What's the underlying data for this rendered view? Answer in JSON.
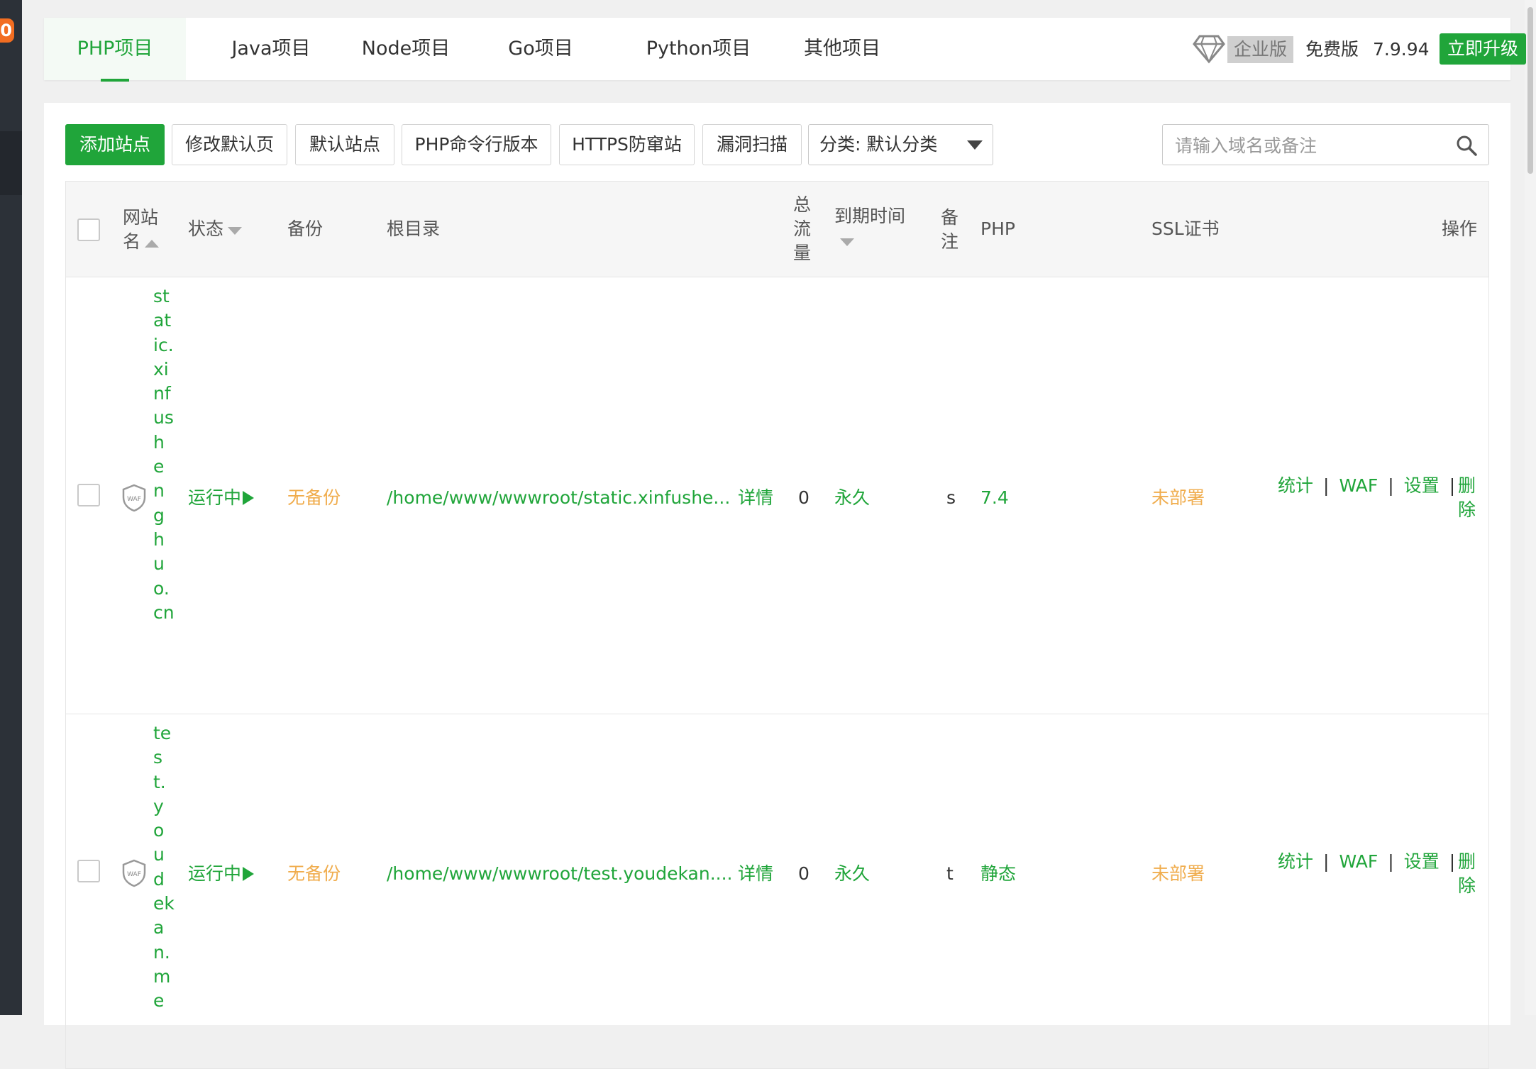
{
  "sidebar": {
    "badge": "0"
  },
  "tabs": [
    {
      "label": "PHP项目"
    },
    {
      "label": "Java项目"
    },
    {
      "label": "Node项目"
    },
    {
      "label": "Go项目"
    },
    {
      "label": "Python项目"
    },
    {
      "label": "其他项目"
    }
  ],
  "version": {
    "enterprise": "企业版",
    "free": "免费版",
    "number": "7.9.94",
    "upgrade": "立即升级"
  },
  "toolbar": {
    "add_site": "添加站点",
    "edit_default_page": "修改默认页",
    "default_site": "默认站点",
    "php_cli": "PHP命令行版本",
    "https_guard": "HTTPS防窜站",
    "vuln_scan": "漏洞扫描",
    "category": "分类: 默认分类",
    "search_placeholder": "请输入域名或备注"
  },
  "columns": {
    "site_name": "网站名",
    "status": "状态",
    "backup": "备份",
    "root": "根目录",
    "traffic": "总流量",
    "expire": "到期时间",
    "remark": "备注",
    "php": "PHP",
    "ssl": "SSL证书",
    "actions": "操作"
  },
  "rows": [
    {
      "name": "static.xinfushenghuo.cn",
      "waf": "WAF",
      "status": "运行中",
      "backup": "无备份",
      "root": "/home/www/wwwroot/static.xinfushe...",
      "detail": "详情",
      "traffic": "0",
      "expire": "永久",
      "remark": "s",
      "php": "7.4",
      "ssl": "未部署"
    },
    {
      "name": "test.youdekan.me",
      "waf": "WAF",
      "status": "运行中",
      "backup": "无备份",
      "root": "/home/www/wwwroot/test.youdekan....",
      "detail": "详情",
      "traffic": "0",
      "expire": "永久",
      "remark": "t",
      "php": "静态",
      "ssl": "未部署"
    }
  ],
  "actions": {
    "stats": "统计",
    "waf": "WAF",
    "settings": "设置",
    "delete": "删除",
    "sep": "|"
  }
}
